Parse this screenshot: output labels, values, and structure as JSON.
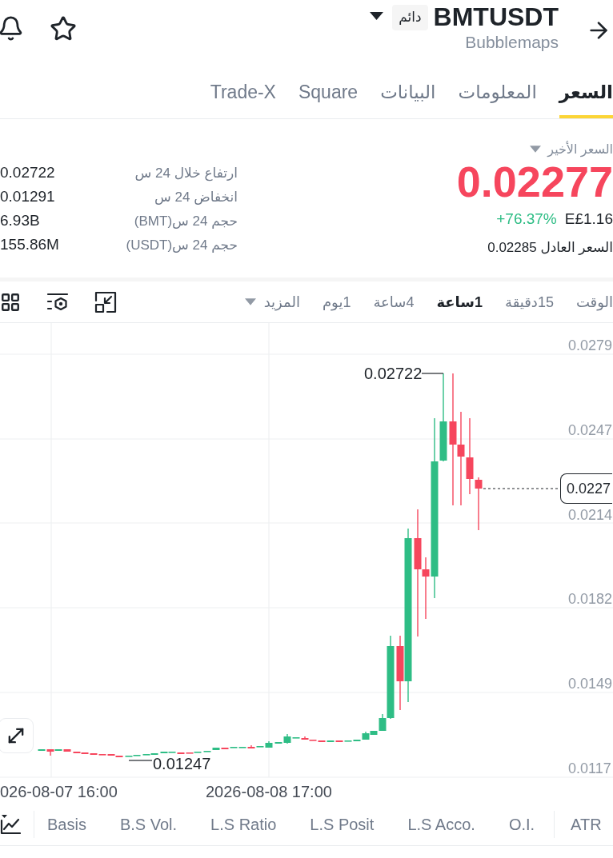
{
  "header": {
    "symbol": "BMTUSDT",
    "contract_badge": "دائم",
    "name": "Bubblemaps"
  },
  "tabs": [
    {
      "label": "السعر",
      "selected": true
    },
    {
      "label": "المعلومات",
      "selected": false
    },
    {
      "label": "البيانات",
      "selected": false
    },
    {
      "label": "Square",
      "selected": false
    },
    {
      "label": "Trade-X",
      "selected": false
    }
  ],
  "price": {
    "label": "السعر الأخير",
    "last": "0.02277",
    "change": "+76.37%",
    "fiat": "E£1.16",
    "fair_price": "السعر العادل 0.02285"
  },
  "stats": [
    {
      "label": "ارتفاع خلال 24 س",
      "value": "0.02722"
    },
    {
      "label": "انخفاض 24 س",
      "value": "0.01291"
    },
    {
      "label": "حجم 24 س(BMT)",
      "value": "6.93B"
    },
    {
      "label": "حجم 24 س(USDT)",
      "value": "155.86M"
    }
  ],
  "intervals": [
    {
      "label": "الوقت",
      "selected": false
    },
    {
      "label": "15دقيقة",
      "selected": false
    },
    {
      "label": "1ساعة",
      "selected": true
    },
    {
      "label": "4ساعة",
      "selected": false
    },
    {
      "label": "1يوم",
      "selected": false
    }
  ],
  "more_menu": "المزيد",
  "chart": {
    "y_axis": [
      "0.0279",
      "0.0247",
      "0.0214",
      "0.0182",
      "0.0149",
      "0.0117"
    ],
    "current_price": "0.0227",
    "high_marker": "0.02722",
    "low_marker": "0.01247",
    "x_axis": [
      "2026-08-08 17:00",
      "026-08-07 16:00"
    ]
  },
  "pinned_indicator": "ATR",
  "indicators": [
    "O.I.",
    "L.S Acco.",
    "L.S Posit",
    "L.S Ratio",
    "B.S Vol.",
    "Basis"
  ]
}
